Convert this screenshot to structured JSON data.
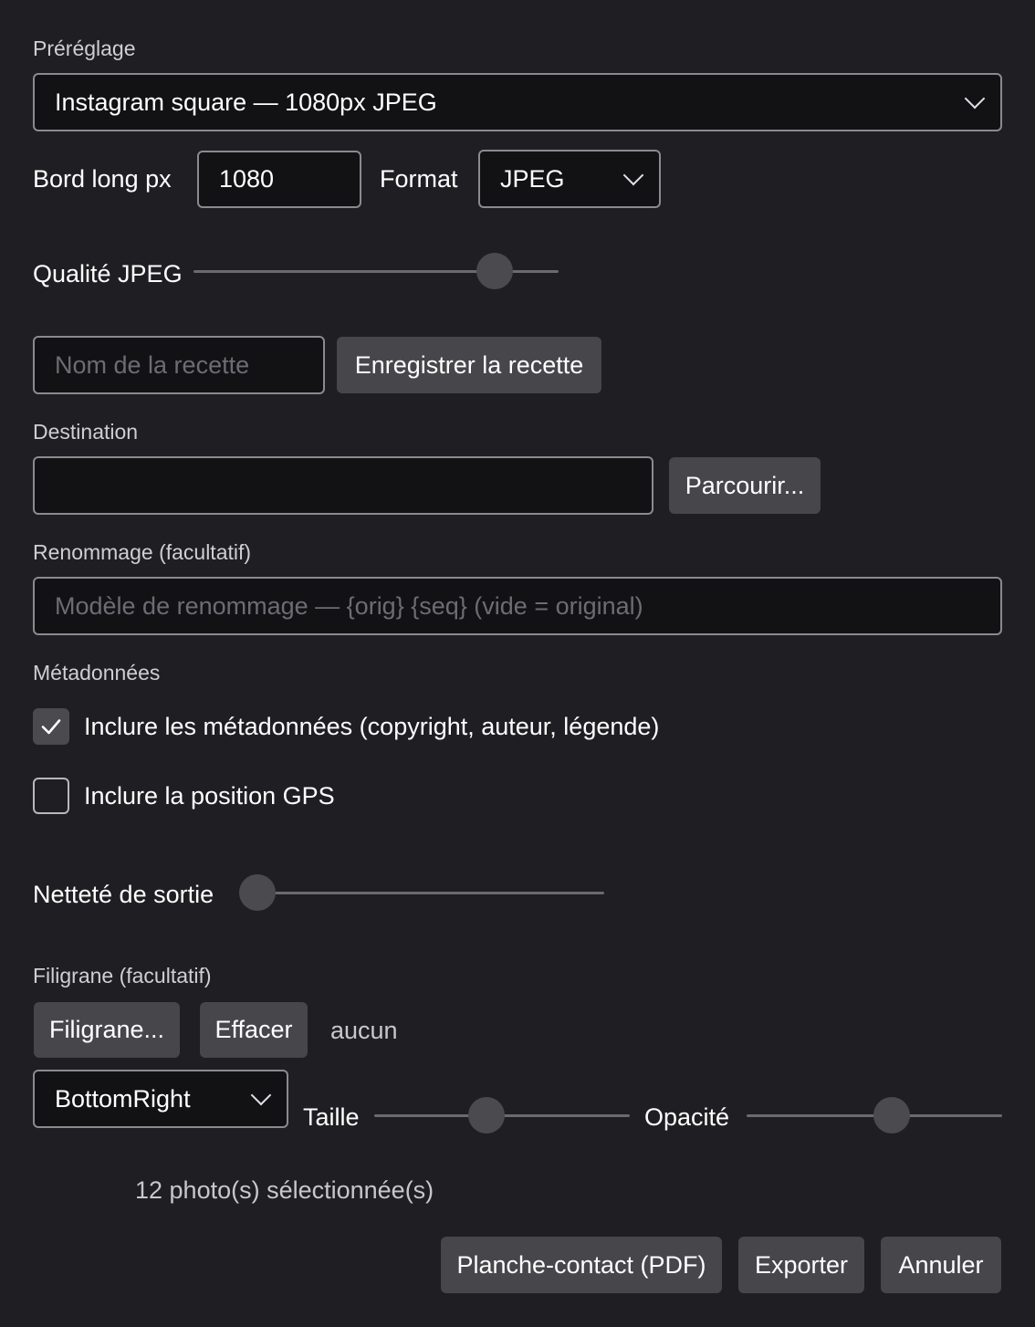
{
  "preset": {
    "label": "Préréglage",
    "value": "Instagram square — 1080px JPEG"
  },
  "long_edge": {
    "label": "Bord long px",
    "value": "1080"
  },
  "format": {
    "label": "Format",
    "value": "JPEG"
  },
  "jpeg_quality": {
    "label": "Qualité JPEG",
    "level": 0.86
  },
  "recipe": {
    "name_placeholder": "Nom de la recette",
    "save_label": "Enregistrer la recette"
  },
  "destination": {
    "label": "Destination",
    "value": "",
    "browse_label": "Parcourir..."
  },
  "rename": {
    "label": "Renommage (facultatif)",
    "placeholder": "Modèle de renommage — {orig} {seq} (vide = original)"
  },
  "metadata": {
    "label": "Métadonnées",
    "include_metadata": {
      "label": "Inclure les métadonnées (copyright, auteur, légende)",
      "checked": true
    },
    "include_gps": {
      "label": "Inclure la position GPS",
      "checked": false
    }
  },
  "sharpening": {
    "label": "Netteté de sortie",
    "level": 0.0
  },
  "watermark": {
    "label": "Filigrane (facultatif)",
    "choose_label": "Filigrane...",
    "clear_label": "Effacer",
    "status": "aucun",
    "position": "BottomRight",
    "size_label": "Taille",
    "size_level": 0.43,
    "opacity_label": "Opacité",
    "opacity_level": 0.58
  },
  "selection_count": "12 photo(s) sélectionnée(s)",
  "actions": {
    "contact_sheet_label": "Planche-contact (PDF)",
    "export_label": "Exporter",
    "cancel_label": "Annuler"
  },
  "colors": {
    "background": "#1f1f23",
    "field_background": "#121215",
    "button_background": "#46464b"
  }
}
